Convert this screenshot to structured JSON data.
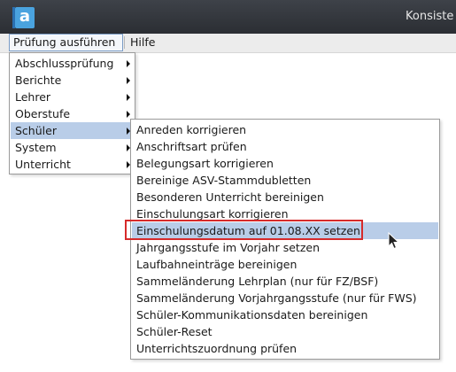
{
  "window": {
    "title": "Konsiste",
    "logo_letter": "a"
  },
  "menubar": {
    "items": [
      {
        "label": "Prüfung ausführen"
      },
      {
        "label": "Hilfe"
      }
    ]
  },
  "main_menu": {
    "items": [
      {
        "label": "Abschlussprüfung"
      },
      {
        "label": "Berichte"
      },
      {
        "label": "Lehrer"
      },
      {
        "label": "Oberstufe"
      },
      {
        "label": "Schüler"
      },
      {
        "label": "System"
      },
      {
        "label": "Unterricht"
      }
    ]
  },
  "submenu": {
    "items": [
      {
        "label": "Anreden korrigieren"
      },
      {
        "label": "Anschriftsart prüfen"
      },
      {
        "label": "Belegungsart korrigieren"
      },
      {
        "label": "Bereinige ASV-Stammdubletten"
      },
      {
        "label": "Besonderen Unterricht bereinigen"
      },
      {
        "label": "Einschulungsart korrigieren"
      },
      {
        "label": "Einschulungsdatum auf 01.08.XX setzen"
      },
      {
        "label": "Jahrgangsstufe im Vorjahr setzen"
      },
      {
        "label": "Laufbahneinträge bereinigen"
      },
      {
        "label": "Sammeländerung Lehrplan (nur für FZ/BSF)"
      },
      {
        "label": "Sammeländerung Vorjahrgangsstufe (nur für FWS)"
      },
      {
        "label": "Schüler-Kommunikationsdaten bereinigen"
      },
      {
        "label": "Schüler-Reset"
      },
      {
        "label": "Unterrichtszuordnung prüfen"
      }
    ]
  },
  "colors": {
    "highlight": "#b9cde8",
    "annotation_box": "#d62b2b",
    "titlebar": "#2f3237",
    "logo": "#4aa3df"
  }
}
